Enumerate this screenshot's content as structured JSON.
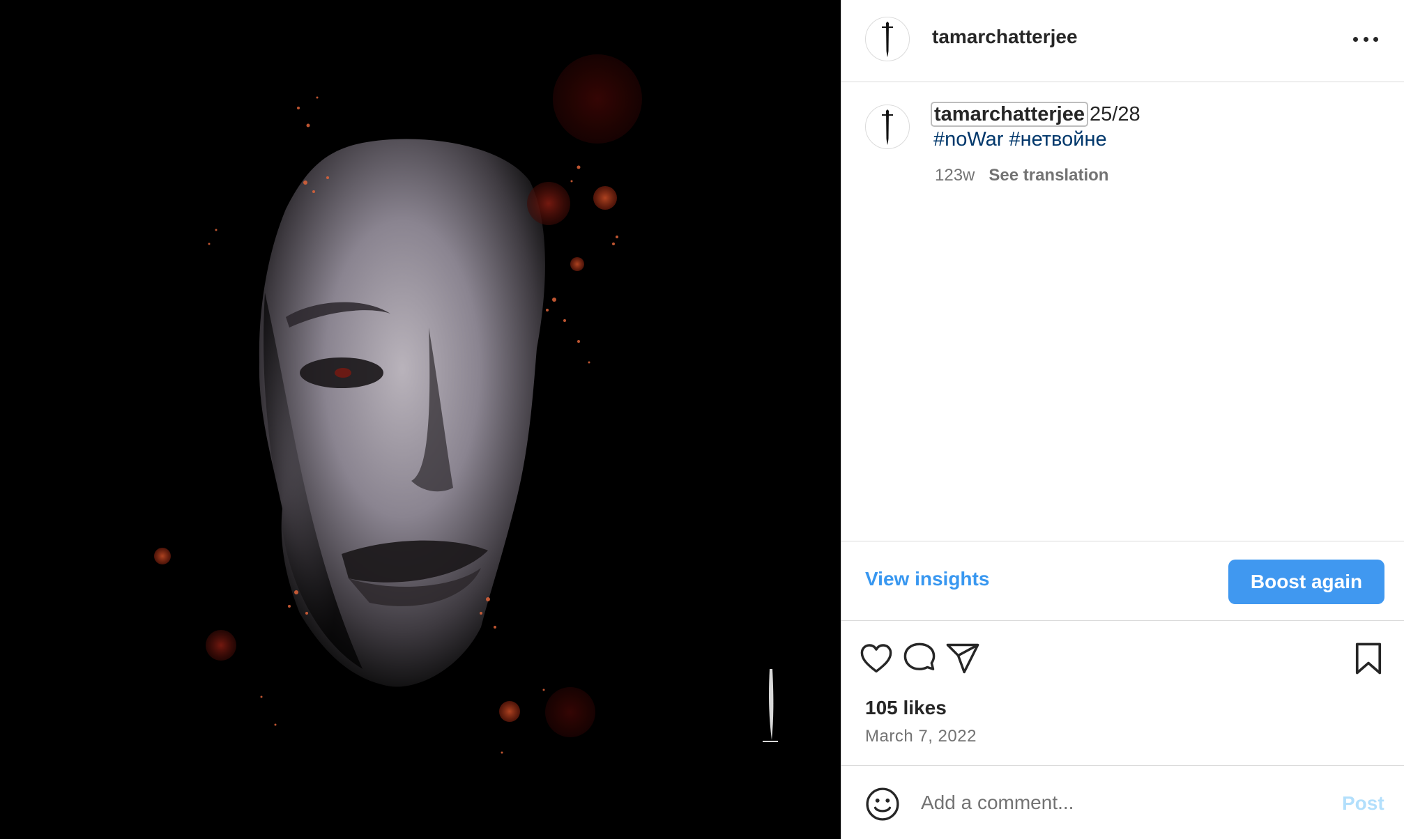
{
  "post": {
    "username": "tamarchatterjee",
    "caption_user": "tamarchatterjee",
    "caption_text": "25/28",
    "hashtags": [
      "#noWar",
      "#нетвойне"
    ],
    "age": "123w",
    "see_translation": "See translation",
    "likes": "105 likes",
    "date": "March 7, 2022"
  },
  "actions": {
    "view_insights": "View insights",
    "boost_again": "Boost again"
  },
  "comment": {
    "placeholder": "Add a comment...",
    "post_label": "Post"
  },
  "icons": {
    "more": "more-options-icon",
    "like": "heart-icon",
    "comment": "comment-bubble-icon",
    "share": "send-paper-plane-icon",
    "save": "bookmark-icon",
    "emoji": "smiley-icon",
    "avatar": "dagger-logo-icon"
  },
  "colors": {
    "link_blue": "#3897f0",
    "button_blue": "#4098f0",
    "hashtag_blue": "#00376b",
    "post_disabled": "#b2dffc",
    "border": "#dbdbdb",
    "secondary_text": "#737373"
  }
}
